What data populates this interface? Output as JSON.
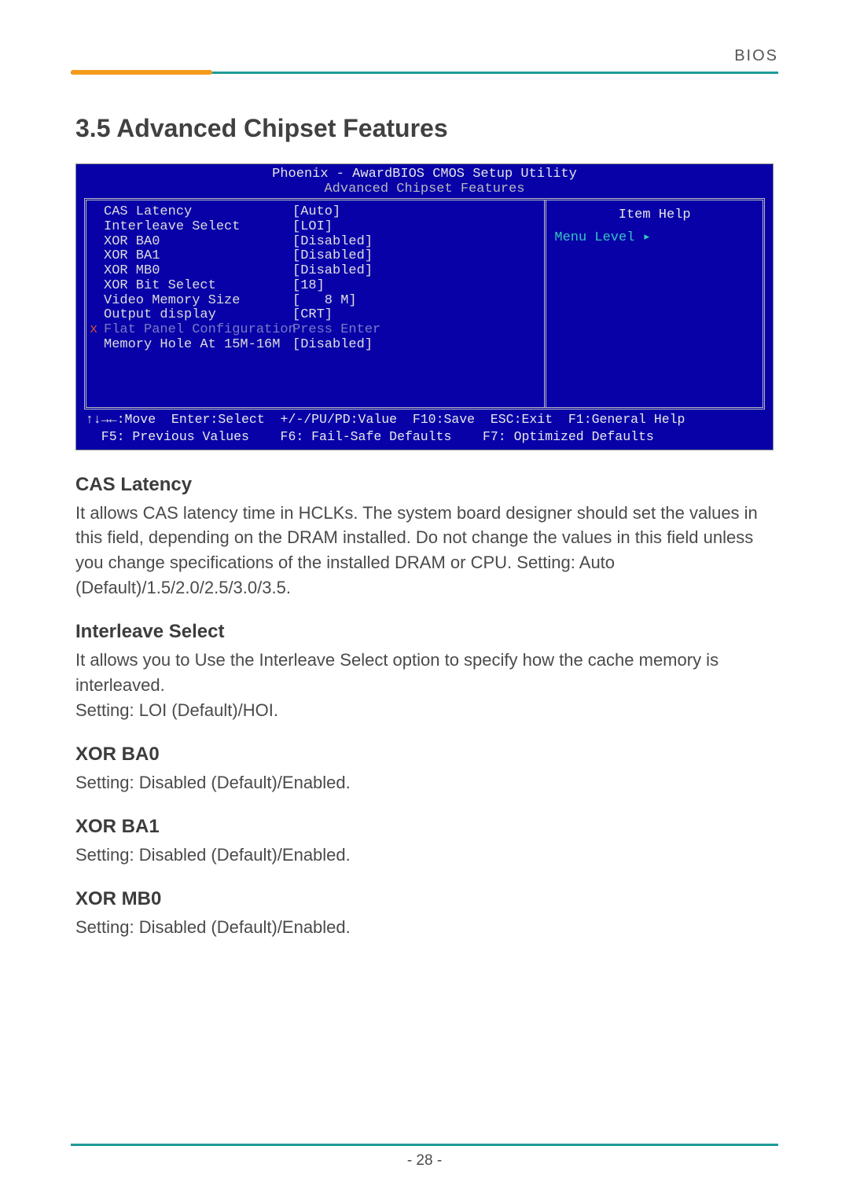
{
  "header": {
    "label": "BIOS"
  },
  "section_title": "3.5 Advanced Chipset Features",
  "bios": {
    "title": "Phoenix - AwardBIOS CMOS Setup Utility",
    "subtitle": "Advanced Chipset Features",
    "items": [
      {
        "label": "CAS Latency",
        "value": "[Auto]",
        "value_class": "val-yellow"
      },
      {
        "label": "Interleave Select",
        "value": "[LOI]"
      },
      {
        "label": "XOR BA0",
        "value": "[Disabled]"
      },
      {
        "label": "XOR BA1",
        "value": "[Disabled]"
      },
      {
        "label": "XOR MB0",
        "value": "[Disabled]"
      },
      {
        "label": "XOR Bit Select",
        "value": "[18]"
      },
      {
        "label": "Video Memory Size",
        "value": "[   8 M]"
      },
      {
        "label": "",
        "value": ""
      },
      {
        "label": "Output display",
        "value": "[CRT]"
      },
      {
        "label": "Flat Panel Configuration",
        "value": "Press Enter",
        "marker": "x",
        "dim": true
      },
      {
        "label": "Memory Hole At 15M-16M",
        "value": "[Disabled]"
      }
    ],
    "help_title": "Item Help",
    "menu_level": "Menu Level   ▸",
    "footer_l1": "↑↓→←:Move  Enter:Select  +/-/PU/PD:Value  F10:Save  ESC:Exit  F1:General Help",
    "footer_l2": "  F5: Previous Values    F6: Fail-Safe Defaults    F7: Optimized Defaults"
  },
  "options": [
    {
      "heading": "CAS Latency",
      "body": "It allows CAS latency time in HCLKs. The system board designer should set the values in this field, depending on the DRAM installed. Do not change the values in this field unless you change specifications of the installed DRAM or CPU. Setting: Auto (Default)/1.5/2.0/2.5/3.0/3.5."
    },
    {
      "heading": "Interleave Select",
      "body": "It allows you to Use the Interleave Select option to specify how the cache memory is interleaved.\nSetting: LOI (Default)/HOI."
    },
    {
      "heading": "XOR BA0",
      "body": "Setting: Disabled (Default)/Enabled."
    },
    {
      "heading": "XOR BA1",
      "body": "Setting: Disabled (Default)/Enabled."
    },
    {
      "heading": "XOR MB0",
      "body": "Setting: Disabled (Default)/Enabled."
    }
  ],
  "page_number": "- 28 -"
}
